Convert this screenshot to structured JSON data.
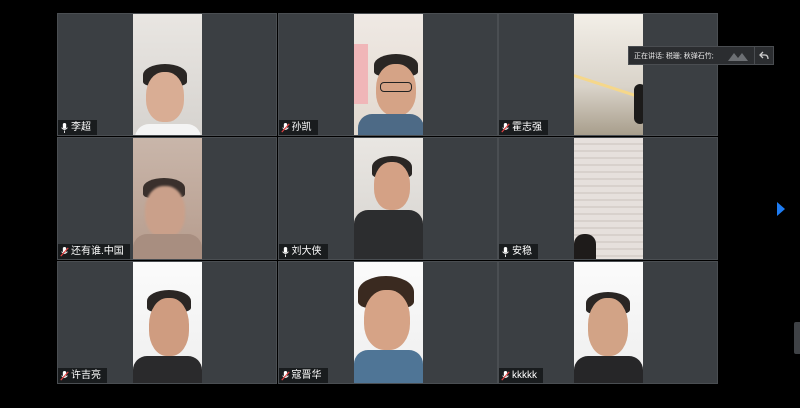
{
  "meeting": {
    "speaking_label": "正在讲话: 税珊; 秋弹石竹;",
    "accent_color": "#1e7cf2"
  },
  "participants": [
    {
      "name": "李超",
      "mic_icon": "mic-icon",
      "video": true
    },
    {
      "name": "孙凯",
      "mic_icon": "mic-muted-icon",
      "video": true
    },
    {
      "name": "霍志强",
      "mic_icon": "mic-muted-icon",
      "video": true
    },
    {
      "name": "还有谁.中国",
      "mic_icon": "mic-muted-icon",
      "video": true
    },
    {
      "name": "刘大侠",
      "mic_icon": "mic-icon",
      "video": true
    },
    {
      "name": "安稳",
      "mic_icon": "mic-icon",
      "video": true
    },
    {
      "name": "许吉亮",
      "mic_icon": "mic-muted-icon",
      "video": true
    },
    {
      "name": "寇晋华",
      "mic_icon": "mic-muted-icon",
      "video": true
    },
    {
      "name": "kkkkk",
      "mic_icon": "mic-muted-icon",
      "video": true
    }
  ],
  "controls": {
    "next_page_icon": "chevron-right-icon",
    "back_icon": "return-icon",
    "signal_icon": "signal-icon"
  }
}
